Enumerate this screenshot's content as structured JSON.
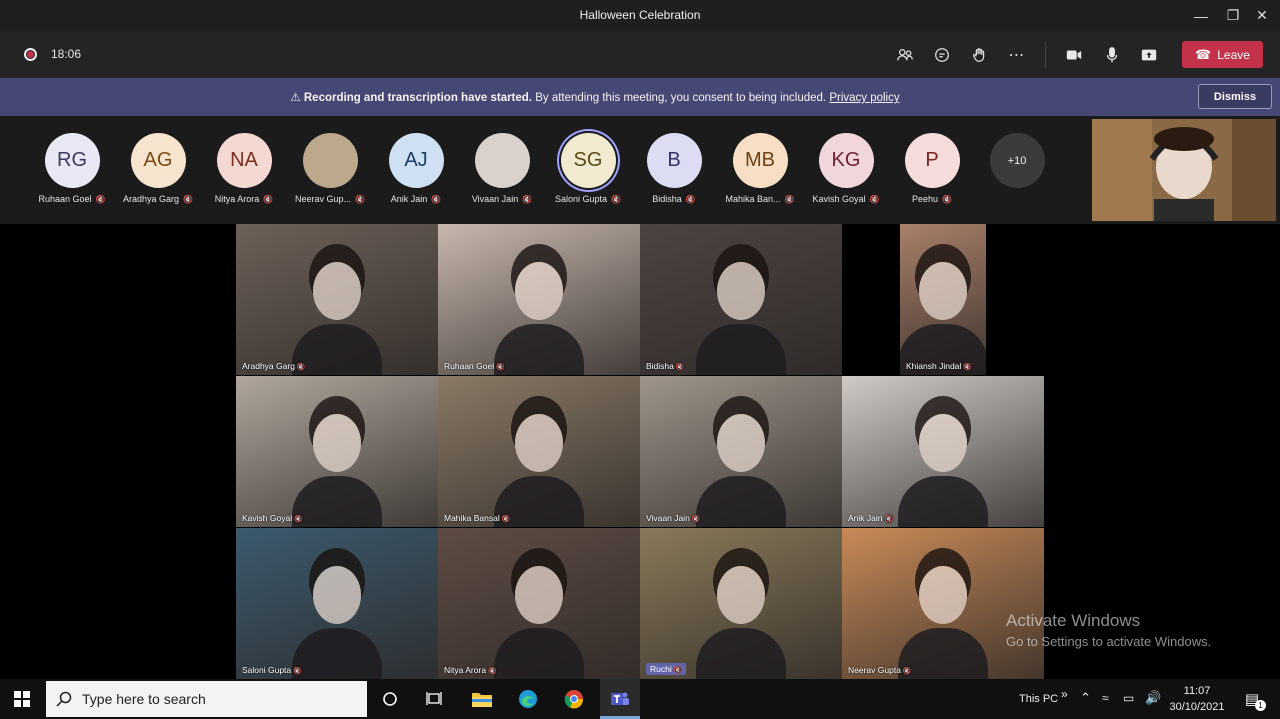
{
  "window": {
    "title": "Halloween Celebration"
  },
  "controls": {
    "timer": "18:06",
    "leave_label": "Leave",
    "leave_color": "#c4314b"
  },
  "banner": {
    "bold_text": "Recording and transcription have started.",
    "text": "By attending this meeting, you consent to being included.",
    "link": "Privacy policy",
    "dismiss_label": "Dismiss",
    "background": "#464775"
  },
  "participants": [
    {
      "initials": "RG",
      "name": "Ruhaan Goel",
      "bg": "#e9e9f5",
      "fg": "#3b3b5a",
      "photo": false
    },
    {
      "initials": "AG",
      "name": "Aradhya Garg",
      "bg": "#f7e4cf",
      "fg": "#7a4a14",
      "photo": false
    },
    {
      "initials": "NA",
      "name": "Nitya Arora",
      "bg": "#f4d8d2",
      "fg": "#7a2f22",
      "photo": false
    },
    {
      "initials": "",
      "name": "Neerav Gup...",
      "bg": "#bca88a",
      "fg": "#fff",
      "photo": true
    },
    {
      "initials": "AJ",
      "name": "Anik Jain",
      "bg": "#cfe0f3",
      "fg": "#1e3e66",
      "photo": false
    },
    {
      "initials": "",
      "name": "Vivaan Jain",
      "bg": "#d9d1cc",
      "fg": "#fff",
      "photo": true
    },
    {
      "initials": "SG",
      "name": "Saloni Gupta",
      "bg": "#f1ead0",
      "fg": "#5a4a14",
      "photo": false
    },
    {
      "initials": "B",
      "name": "Bidisha",
      "bg": "#dcdcf3",
      "fg": "#33336a",
      "photo": false
    },
    {
      "initials": "MB",
      "name": "Mahika Ban...",
      "bg": "#f6dfc4",
      "fg": "#6e4216",
      "photo": false
    },
    {
      "initials": "KG",
      "name": "Kavish Goyal",
      "bg": "#f1d6dc",
      "fg": "#6e2436",
      "photo": false
    },
    {
      "initials": "P",
      "name": "Peehu",
      "bg": "#f7dcdc",
      "fg": "#7a2424",
      "photo": false
    }
  ],
  "more_count": "+10",
  "tiles": [
    {
      "name": "Aradhya Garg",
      "color": "#6d6158"
    },
    {
      "name": "Ruhaan  Goel",
      "color": "#c7b7ad"
    },
    {
      "name": "Bidisha",
      "color": "#4d4442"
    },
    {
      "name": "Khiansh  Jindal",
      "color": "#a9806a"
    },
    {
      "name": "Kavish  Goyal",
      "color": "#b0a69c"
    },
    {
      "name": "Mahika Bansal",
      "color": "#8a7a66"
    },
    {
      "name": "Vivaan Jain",
      "color": "#9e948a"
    },
    {
      "name": "Anik  Jain",
      "color": "#cfcac6"
    },
    {
      "name": "Saloni Gupta",
      "color": "#3c5a6e"
    },
    {
      "name": "Nitya Arora",
      "color": "#5e4c44"
    },
    {
      "name": "Ruchi",
      "color": "#8a7a5a"
    },
    {
      "name": "Neerav  Gupta",
      "color": "#c88a58"
    }
  ],
  "watermark": {
    "line1": "Activate Windows",
    "line2": "Go to Settings to activate Windows."
  },
  "taskbar": {
    "search_placeholder": "Type here to search",
    "this_pc": "This PC",
    "time": "11:07",
    "date": "30/10/2021",
    "notification_count": "1"
  }
}
